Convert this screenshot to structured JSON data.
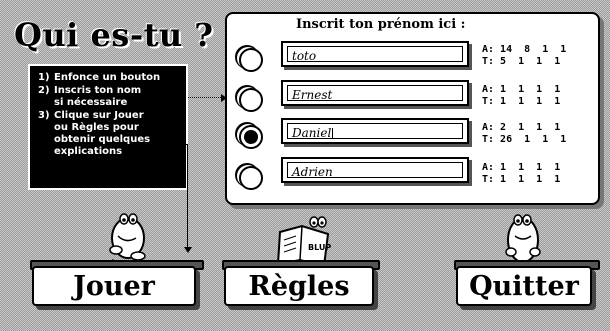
{
  "title": "Qui es-tu ?",
  "instructions": [
    {
      "num": "1)",
      "text": "Enfonce un bouton"
    },
    {
      "num": "2)",
      "text": "Inscris ton nom\nsi nécessaire"
    },
    {
      "num": "3)",
      "text": "Clique sur Jouer\nou Règles pour\nobtenir quelques\nexplications"
    }
  ],
  "panel": {
    "header": "Inscrit ton prénom ici :",
    "rows": [
      {
        "name": "toto",
        "selected": false,
        "a": "A: 14  8  1  1",
        "t": "T: 5  1  1  1"
      },
      {
        "name": "Ernest",
        "selected": false,
        "a": "A: 1  1  1  1",
        "t": "T: 1  1  1  1"
      },
      {
        "name": "Daniel",
        "selected": true,
        "a": "A: 2  1  1  1",
        "t": "T: 26  1  1  1"
      },
      {
        "name": "Adrien",
        "selected": false,
        "a": "A: 1  1  1  1",
        "t": "T: 1  1  1  1"
      }
    ]
  },
  "book_label": "BLUP",
  "buttons": {
    "play": "Jouer",
    "rules": "Règles",
    "quit": "Quitter"
  }
}
